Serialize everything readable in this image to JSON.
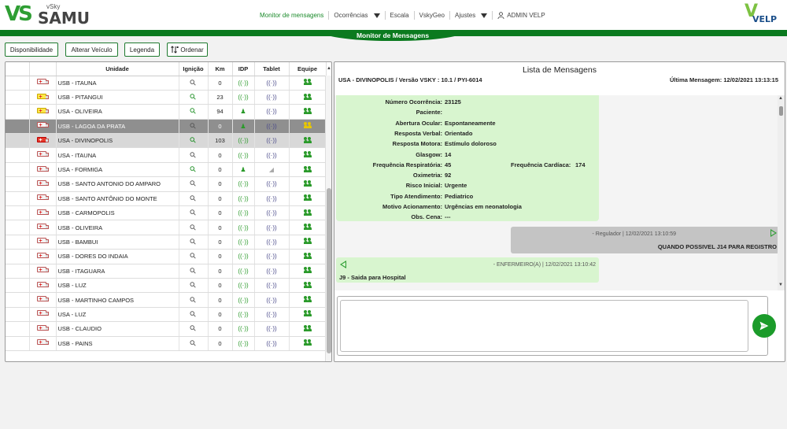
{
  "brand": {
    "vs": "VS",
    "vsky": "vSky",
    "samu": "SAMU",
    "velp": "VELP"
  },
  "nav": {
    "items": [
      {
        "label": "Monitor de mensagens",
        "active": true,
        "dropdown": false
      },
      {
        "label": "Ocorrências",
        "active": false,
        "dropdown": true
      },
      {
        "label": "Escala",
        "active": false,
        "dropdown": false
      },
      {
        "label": "VskyGeo",
        "active": false,
        "dropdown": false
      },
      {
        "label": "Ajustes",
        "active": false,
        "dropdown": true
      }
    ],
    "user": "ADMIN VELP"
  },
  "page_tab": "Monitor de Mensagens",
  "toolbar": {
    "disponibilidade": "Disponibilidade",
    "alterar_veiculo": "Alterar Veículo",
    "legenda": "Legenda",
    "ordenar": "Ordenar"
  },
  "units_table": {
    "headers": {
      "unidade": "Unidade",
      "ignicao": "Ignição",
      "km": "Km",
      "idp": "IDP",
      "tablet": "Tablet",
      "equipe": "Equipe"
    },
    "rows": [
      {
        "name": "USB - ITAUNA",
        "km": "0",
        "amb": "light",
        "key": "grey",
        "idp": "signal",
        "team": "green",
        "state": ""
      },
      {
        "name": "USB - PITANGUI",
        "km": "23",
        "amb": "yellow",
        "key": "green",
        "idp": "signal",
        "team": "green",
        "state": ""
      },
      {
        "name": "USA - OLIVEIRA",
        "km": "94",
        "amb": "yellow",
        "key": "green",
        "idp": "person",
        "team": "green",
        "state": ""
      },
      {
        "name": "USB - LAGOA DA PRATA",
        "km": "0",
        "amb": "light",
        "key": "grey",
        "idp": "person",
        "team": "yellow",
        "state": "selected-dark"
      },
      {
        "name": "USA - DIVINOPOLIS",
        "km": "103",
        "amb": "red",
        "key": "green",
        "idp": "signal",
        "team": "green",
        "state": "selected-light"
      },
      {
        "name": "USA - ITAUNA",
        "km": "0",
        "amb": "light",
        "key": "grey",
        "idp": "signal",
        "team": "green",
        "state": ""
      },
      {
        "name": "USA - FORMIGA",
        "km": "0",
        "amb": "light",
        "key": "green",
        "idp": "person",
        "team": "green",
        "state": ""
      },
      {
        "name": "USB - SANTO ANTONIO DO AMPARO",
        "km": "0",
        "amb": "light",
        "key": "grey",
        "idp": "signal",
        "team": "green",
        "state": ""
      },
      {
        "name": "USB - SANTO ANTÔNIO DO MONTE",
        "km": "0",
        "amb": "light",
        "key": "grey",
        "idp": "signal",
        "team": "green",
        "state": ""
      },
      {
        "name": "USB - CARMOPOLIS",
        "km": "0",
        "amb": "light",
        "key": "grey",
        "idp": "signal",
        "team": "green",
        "state": ""
      },
      {
        "name": "USB - OLIVEIRA",
        "km": "0",
        "amb": "light",
        "key": "grey",
        "idp": "signal",
        "team": "green",
        "state": ""
      },
      {
        "name": "USB - BAMBUI",
        "km": "0",
        "amb": "light",
        "key": "grey",
        "idp": "signal",
        "team": "green",
        "state": ""
      },
      {
        "name": "USB - DORES DO INDAIA",
        "km": "0",
        "amb": "light",
        "key": "grey",
        "idp": "signal",
        "team": "green",
        "state": ""
      },
      {
        "name": "USB - ITAGUARA",
        "km": "0",
        "amb": "light",
        "key": "grey",
        "idp": "signal",
        "team": "green",
        "state": ""
      },
      {
        "name": "USB - LUZ",
        "km": "0",
        "amb": "light",
        "key": "grey",
        "idp": "signal",
        "team": "green",
        "state": ""
      },
      {
        "name": "USB - MARTINHO CAMPOS",
        "km": "0",
        "amb": "light",
        "key": "grey",
        "idp": "signal",
        "team": "green",
        "state": ""
      },
      {
        "name": "USA - LUZ",
        "km": "0",
        "amb": "light",
        "key": "grey",
        "idp": "signal",
        "team": "green",
        "state": ""
      },
      {
        "name": "USB - CLAUDIO",
        "km": "0",
        "amb": "light",
        "key": "grey",
        "idp": "signal",
        "team": "green",
        "state": ""
      },
      {
        "name": "USB - PAINS",
        "km": "0",
        "amb": "light",
        "key": "grey",
        "idp": "signal",
        "team": "green",
        "state": ""
      }
    ]
  },
  "messages_panel": {
    "title": "Lista de Mensagens",
    "subtitle": "USA - DIVINOPOLIS / Versão VSKY : 10.1 / PYI-6014",
    "last_message": "Última Mensagem: 12/02/2021 13:13:15",
    "details": [
      {
        "k": "Número Ocorrência:",
        "v": "23125"
      },
      {
        "k": "Paciente:",
        "v": ""
      },
      {
        "k": "Abertura Ocular:",
        "v": "Espontaneamente"
      },
      {
        "k": "Resposta Verbal:",
        "v": "Orientado"
      },
      {
        "k": "Resposta Motora:",
        "v": "Estímulo doloroso"
      },
      {
        "k": "Glasgow:",
        "v": "14"
      },
      {
        "k": "Frequência Respiratória:",
        "v": "45"
      },
      {
        "k": "Oximetria:",
        "v": "92"
      },
      {
        "k": "Risco Inicial:",
        "v": "Urgente"
      },
      {
        "k": "Tipo Atendimento:",
        "v": "Pediatrico"
      },
      {
        "k": "Motivo Acionamento:",
        "v": "Urgências em neonatologia"
      },
      {
        "k": "Obs. Cena:",
        "v": "---"
      }
    ],
    "extra": {
      "k": "Frequência Cardíaca:",
      "v": "174"
    },
    "sent_message": {
      "meta": "- Regulador | 12/02/2021 13:10:59",
      "text": "QUANDO POSSIVEL J14 PARA REGISTRO"
    },
    "received_message": {
      "meta": "- ENFERMEIRO(A) | 12/02/2021 13:10:42",
      "text": "J9 - Saida para Hospital"
    },
    "composer_value": ""
  },
  "colors": {
    "accent": "#0b7a1f",
    "received_bg": "#d8f5cf",
    "sent_bg": "#c4c4c4",
    "send_button": "#1b9b2a"
  }
}
